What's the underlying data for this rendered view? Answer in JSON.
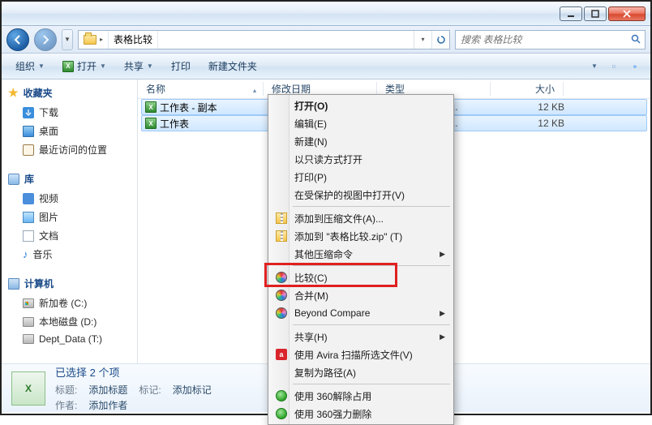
{
  "window": {
    "breadcrumb_root_icon": "folder",
    "breadcrumb_current": "表格比较",
    "search_placeholder": "搜索 表格比较"
  },
  "toolbar": {
    "organize": "组织",
    "open": "打开",
    "share": "共享",
    "print": "打印",
    "new_folder": "新建文件夹"
  },
  "sidebar": {
    "favorites": {
      "label": "收藏夹",
      "items": [
        {
          "label": "下载"
        },
        {
          "label": "桌面"
        },
        {
          "label": "最近访问的位置"
        }
      ]
    },
    "libraries": {
      "label": "库",
      "items": [
        {
          "label": "视频"
        },
        {
          "label": "图片"
        },
        {
          "label": "文档"
        },
        {
          "label": "音乐"
        }
      ]
    },
    "computer": {
      "label": "计算机",
      "items": [
        {
          "label": "新加卷 (C:)"
        },
        {
          "label": "本地磁盘 (D:)"
        },
        {
          "label": "Dept_Data (T:)"
        }
      ]
    }
  },
  "columns": {
    "name": "名称",
    "date": "修改日期",
    "type": "类型",
    "size": "大小"
  },
  "files": [
    {
      "name": "工作表 - 副本",
      "type": "Microsoft Excel ...",
      "size": "12 KB"
    },
    {
      "name": "工作表",
      "type": "Microsoft Excel ...",
      "size": "12 KB"
    }
  ],
  "details": {
    "selected_text": "已选择 2 个项",
    "title_label": "标题:",
    "title_value": "添加标题",
    "author_label": "作者:",
    "author_value": "添加作者",
    "tags_label": "标记:",
    "tags_value": "添加标记"
  },
  "context_menu": {
    "open": "打开(O)",
    "edit": "编辑(E)",
    "new": "新建(N)",
    "open_readonly": "以只读方式打开",
    "print": "打印(P)",
    "open_protected": "在受保护的视图中打开(V)",
    "add_to_archive": "添加到压缩文件(A)...",
    "add_to_zip": "添加到 \"表格比较.zip\" (T)",
    "other_zip": "其他压缩命令",
    "compare": "比较(C)",
    "merge": "合并(M)",
    "beyond_compare": "Beyond Compare",
    "share": "共享(H)",
    "avira": "使用 Avira 扫描所选文件(V)",
    "copy_path": "复制为路径(A)",
    "sh360_unlock": "使用 360解除占用",
    "sh360_shred": "使用 360强力删除"
  },
  "highlight_item": "compare"
}
